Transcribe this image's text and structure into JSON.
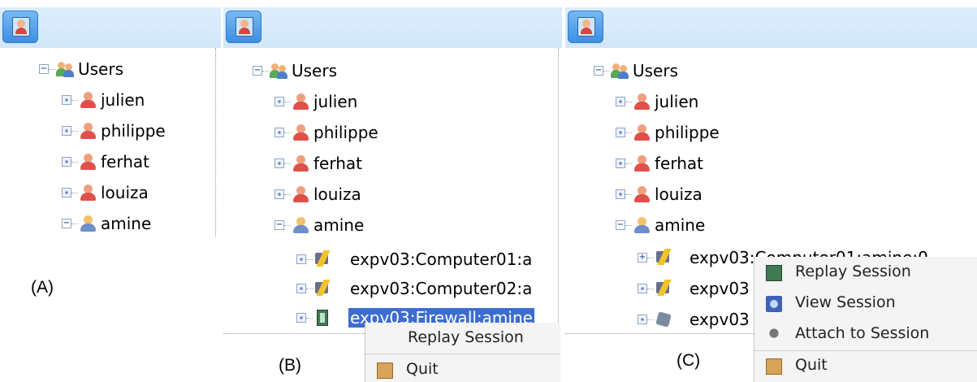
{
  "panels": [
    {
      "caption": "(A)",
      "tree": {
        "root": "Users",
        "users": [
          "julien",
          "philippe",
          "ferhat",
          "louiza",
          "amine"
        ]
      }
    },
    {
      "caption": "(B)",
      "tree": {
        "root": "Users",
        "users": [
          "julien",
          "philippe",
          "ferhat",
          "louiza",
          "amine"
        ],
        "sessions": [
          "expv03:Computer01:a",
          "expv03:Computer02:a",
          "expv03:Firewall:amine"
        ]
      },
      "context_menu": {
        "items": [
          "Replay Session",
          "Quit"
        ]
      }
    },
    {
      "caption": "(C)",
      "tree": {
        "root": "Users",
        "users": [
          "julien",
          "philippe",
          "ferhat",
          "louiza",
          "amine"
        ],
        "sessions": [
          "expv03:Computer01:amine:0",
          "expv03",
          "expv03"
        ]
      },
      "context_menu": {
        "items": [
          "Replay Session",
          "View Session",
          "Attach to Session",
          "Quit"
        ]
      }
    }
  ],
  "icons": {
    "toolbar": "user-icon",
    "root": "users-group-icon",
    "user": "user-icon",
    "amine": "user-edit-icon",
    "session": "session-bolt-icon",
    "firewall": "film-icon",
    "attach": "attach-icon",
    "quit": "door-icon",
    "replay": "film-icon",
    "view": "view-icon"
  },
  "colors": {
    "selection": "#3d6ccd",
    "toolbar": "#d2e6fa",
    "menu": "#f4f4f4"
  }
}
